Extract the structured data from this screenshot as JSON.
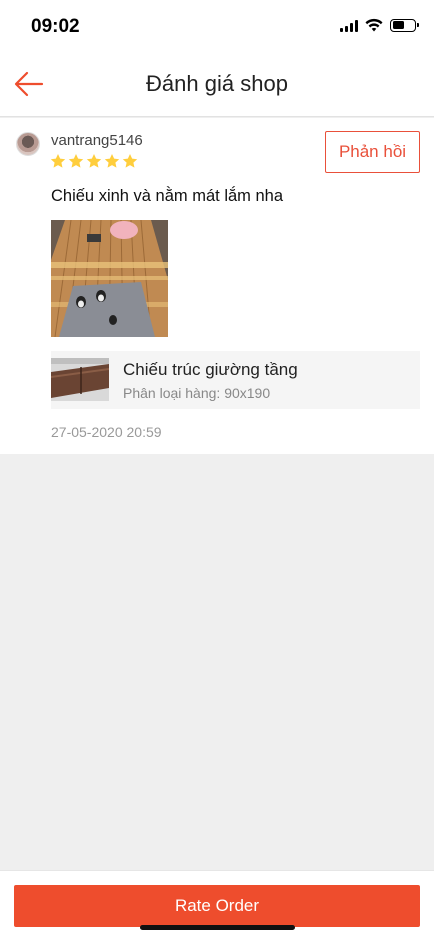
{
  "status_bar": {
    "time": "09:02"
  },
  "header": {
    "title": "Đánh giá shop"
  },
  "review": {
    "username": "vantrang5146",
    "rating": 5,
    "rating_max": 5,
    "reply_label": "Phản hồi",
    "text": "Chiếu xinh và nằm mát lắm nha",
    "product": {
      "name": "Chiếu trúc giường tầng",
      "variant": "Phân loại hàng: 90x190"
    },
    "date": "27-05-2020 20:59"
  },
  "footer": {
    "rate_order_label": "Rate Order"
  },
  "colors": {
    "accent": "#ee4d2d",
    "star": "#ffce3d"
  },
  "icons": [
    "back-arrow-icon",
    "star-icon",
    "signal-icon",
    "wifi-icon",
    "battery-icon"
  ]
}
